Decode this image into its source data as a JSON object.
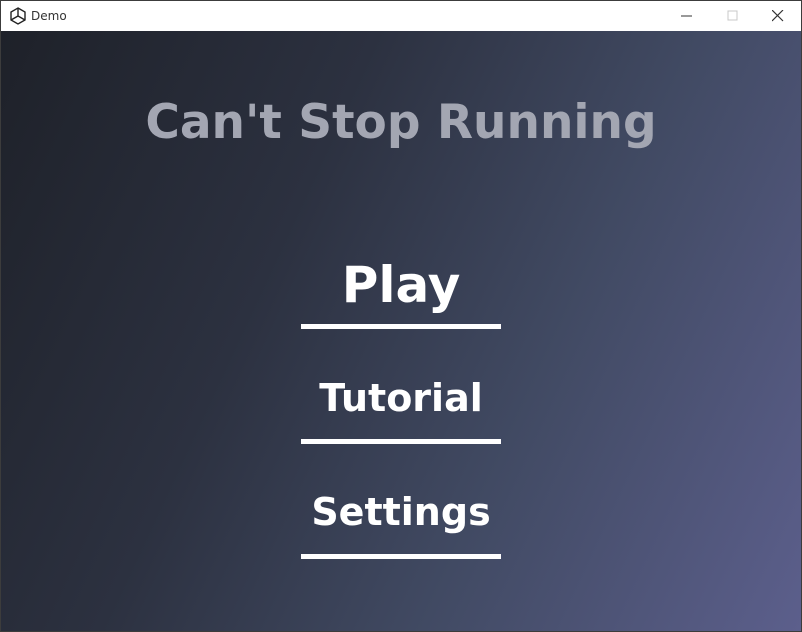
{
  "window": {
    "title": "Demo",
    "controls": [
      "minimize-icon",
      "maximize-icon",
      "close-icon"
    ]
  },
  "game": {
    "title": "Can't Stop Running",
    "menu": {
      "play": "Play",
      "tutorial": "Tutorial",
      "settings": "Settings"
    },
    "colors": {
      "background_dark": "#1e2129",
      "background_light": "#5c5f8c",
      "title_text": "#a3a6b2",
      "menu_text": "#ffffff"
    }
  }
}
